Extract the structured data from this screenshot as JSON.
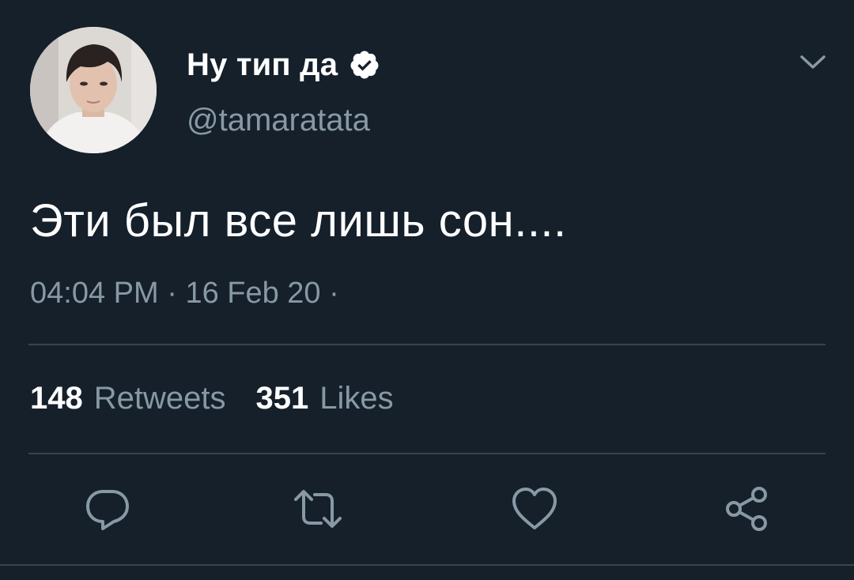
{
  "tweet": {
    "author": {
      "display_name": "Ну тип да",
      "handle": "@tamaratata",
      "verified": true
    },
    "text": "Эти был все лишь сон....",
    "time": "04:04 PM",
    "date": "16 Feb 20",
    "separator": "·",
    "stats": {
      "retweets_count": "148",
      "retweets_label": "Retweets",
      "likes_count": "351",
      "likes_label": "Likes"
    },
    "actions": [
      "reply-icon",
      "retweet-icon",
      "like-icon",
      "share-icon"
    ]
  },
  "colors": {
    "background": "#15202b",
    "text_primary": "#ffffff",
    "text_secondary": "#8899a6",
    "divider": "#38444d",
    "verified_badge": "#ffffff"
  }
}
